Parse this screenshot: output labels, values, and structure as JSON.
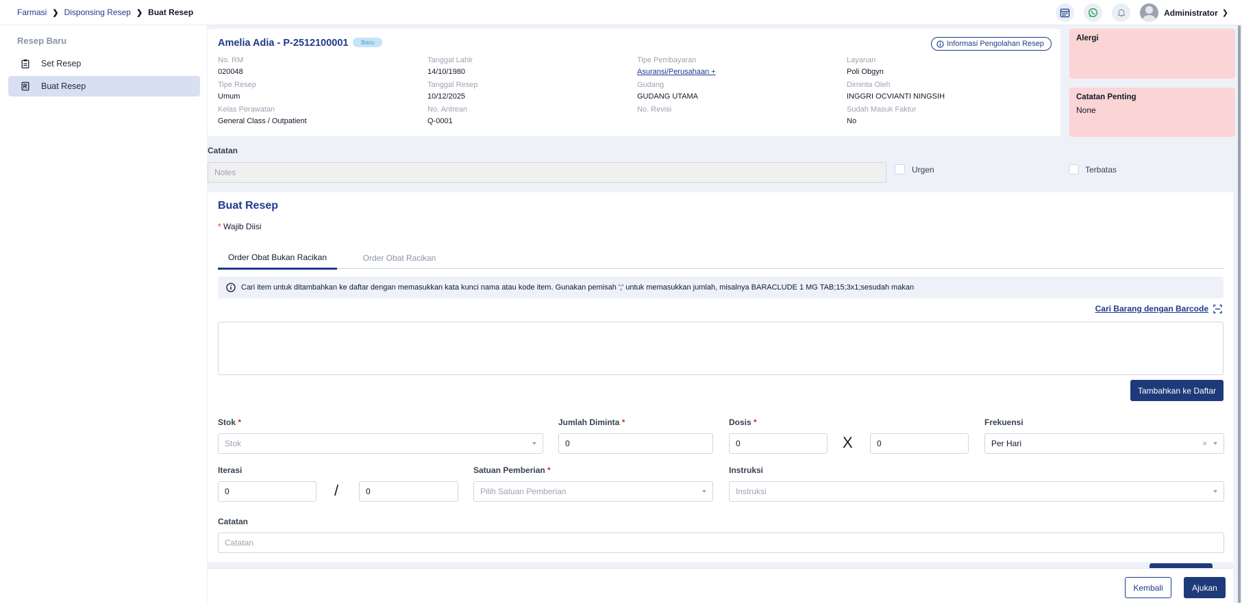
{
  "breadcrumb": [
    "Farmasi",
    "Disponsing Resep",
    "Buat Resep"
  ],
  "topbar": {
    "icons": [
      "calendar-icon",
      "whatsapp-icon",
      "bell-icon"
    ],
    "user_name": "Administrator"
  },
  "sidebar": {
    "title": "Resep Baru",
    "items": [
      {
        "label": "Set Resep",
        "icon": "clipboard-icon",
        "active": false
      },
      {
        "label": "Buat Resep",
        "icon": "prescription-icon",
        "active": true
      }
    ]
  },
  "patient": {
    "name": "Amelia Adia - P-2512100001",
    "badge": "Baru",
    "info_button": "Informasi Pengolahan Resep",
    "fields": [
      {
        "label": "No. RM",
        "value": "020048"
      },
      {
        "label": "Tanggal Lahir",
        "value": "14/10/1980"
      },
      {
        "label": "Tipe Pembayaran",
        "value": "Asuransi/Perusahaan +"
      },
      {
        "label": "Layanan",
        "value": "Poli Obgyn"
      },
      {
        "label": "Tipe Resep",
        "value": "Umum"
      },
      {
        "label": "Tanggal Resep",
        "value": "10/12/2025"
      },
      {
        "label": "Gudang",
        "value": "GUDANG UTAMA"
      },
      {
        "label": "Diminta Oleh",
        "value": "INGGRI OCVIANTI NINGSIH"
      },
      {
        "label": "Kelas Perawatan",
        "value": "General Class / Outpatient"
      },
      {
        "label": "No. Antrean",
        "value": "Q-0001"
      },
      {
        "label": "No. Revisi",
        "value": ""
      },
      {
        "label": "Sudah Masuk Faktur",
        "value": "No"
      }
    ]
  },
  "allergy": {
    "title": "Alergi",
    "value": ""
  },
  "important_note": {
    "title": "Catatan Penting",
    "value": "None"
  },
  "catatan": {
    "label": "Catatan",
    "placeholder": "Notes",
    "urgent_label": "Urgen",
    "restricted_label": "Terbatas"
  },
  "form": {
    "title": "Buat Resep",
    "required_mark": "*",
    "required_note": "Wajib Diisi",
    "tabs": [
      "Order Obat Bukan Racikan",
      "Order Obat Racikan"
    ],
    "hint": "Cari item untuk ditambahkan ke daftar dengan memasukkan kata kunci nama atau kode item. Gunakan pemisah ';' untuk memasukkan jumlah, misalnya BARACLUDE 1 MG TAB;15;3x1;sesudah makan",
    "barcode_link": "Cari Barang dengan Barcode",
    "add_button": "Tambahkan ke Daftar",
    "stok": {
      "label": "Stok",
      "placeholder": "Stok"
    },
    "jumlah": {
      "label": "Jumlah Diminta",
      "value": "0"
    },
    "dosis": {
      "label": "Dosis",
      "value_a": "0",
      "times": "X",
      "value_b": "0"
    },
    "frekuensi": {
      "label": "Frekuensi",
      "value": "Per Hari"
    },
    "iterasi": {
      "label": "Iterasi",
      "value_a": "0",
      "slash": "/",
      "value_b": "0"
    },
    "satuan": {
      "label": "Satuan Pemberian",
      "placeholder": "Pilih Satuan Pemberian"
    },
    "instruksi": {
      "label": "Instruksi",
      "placeholder": "Instruksi"
    },
    "catatan": {
      "label": "Catatan",
      "placeholder": "Catatan"
    }
  },
  "footer": {
    "back_button": "Kembali",
    "submit_button": "Ajukan"
  },
  "colors": {
    "primary": "#1e3a7a",
    "alert_bg": "#fbd5d5",
    "page_bg": "#eef2f8"
  }
}
